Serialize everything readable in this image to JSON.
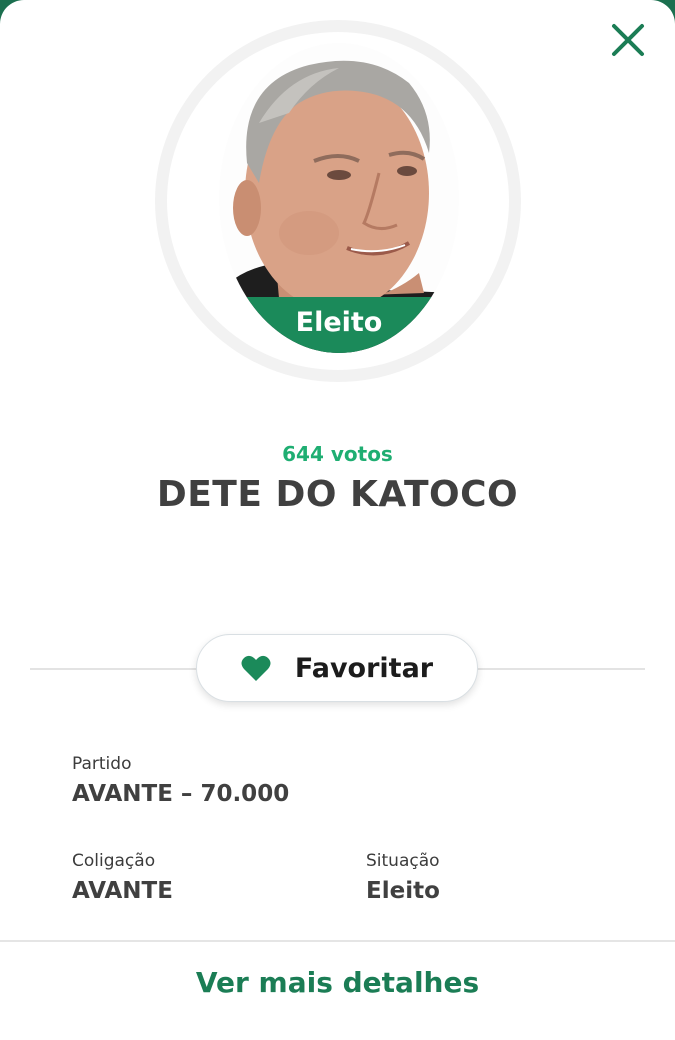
{
  "colors": {
    "accent": "#1b8a5a",
    "votes": "#1fae72",
    "link": "#1b7d55",
    "close": "#1b7d55"
  },
  "header": {
    "close_icon": "close-icon"
  },
  "candidate": {
    "photo_icon": "candidate-photo",
    "status_badge": "Eleito",
    "votes": "644 votos",
    "name": "DETE DO KATOCO"
  },
  "actions": {
    "favorite_label": "Favoritar",
    "favorite_icon": "heart-icon"
  },
  "details": {
    "party_label": "Partido",
    "party_value": "AVANTE – 70.000",
    "coalition_label": "Coligação",
    "coalition_value": "AVANTE",
    "situation_label": "Situação",
    "situation_value": "Eleito"
  },
  "footer": {
    "more_details_label": "Ver mais detalhes"
  }
}
